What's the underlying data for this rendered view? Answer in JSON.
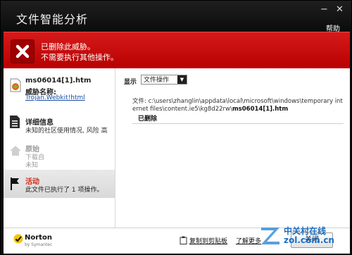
{
  "window": {
    "title": "文件智能分析",
    "help": "帮助",
    "minimize": "−",
    "close": "✕"
  },
  "alert": {
    "line1": "已删除此威胁。",
    "line2": "不需要执行其他操作。"
  },
  "sidebar": {
    "file_name": "ms06014[1].htm",
    "threat_label": "威胁名称:",
    "threat_name": "Trojan.Webkit!html",
    "details_title": "详细信息",
    "details_sub": "未知的社区使用情况, 风险 高",
    "origin_title": "原始",
    "origin_sub1": "下载自",
    "origin_sub2": "未知",
    "activity_title": "活动",
    "activity_sub": "此文件已执行了 1 项操作。"
  },
  "main": {
    "show_label": "显示",
    "select_value": "文件操作",
    "path_prefix": "文件: c:\\users\\zhanglin\\appdata\\local\\microsoft\\windows\\temporary internet files\\content.ie5\\kg8d22rw\\",
    "path_file": "ms06014[1].htm",
    "status": "已删除"
  },
  "footer": {
    "brand": "Norton",
    "brand_sub": "by Symantec",
    "copy_link": "复制到剪贴板",
    "more_link": "了解更多",
    "close_button": "关闭"
  },
  "watermark": {
    "cn": "中关村在线",
    "en": "zol.com.cn"
  },
  "colors": {
    "alert_red": "#c80c0c",
    "activity_red": "#d22a1a",
    "link_blue": "#1a4fa3",
    "title_bar": "#0d0d0d"
  }
}
